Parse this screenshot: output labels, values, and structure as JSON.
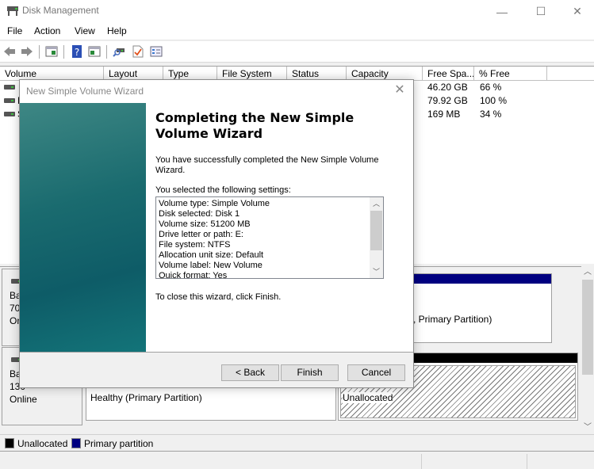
{
  "window": {
    "title": "Disk Management",
    "controls": {
      "minimize": "—",
      "maximize": "☐",
      "close": "✕"
    }
  },
  "menu": [
    "File",
    "Action",
    "View",
    "Help"
  ],
  "toolbar": {
    "icons": [
      "back-arrow",
      "forward-arrow",
      "show-hide-console-tree",
      "help",
      "show-action-pane",
      "connect-disk",
      "check-document",
      "properties-list"
    ]
  },
  "volume_list": {
    "columns": [
      "Volume",
      "Layout",
      "Type",
      "File System",
      "Status",
      "Capacity",
      "Free Spa...",
      "% Free"
    ],
    "rows": [
      {
        "volume": "",
        "free_space": "46.20 GB",
        "pct_free": "66 %"
      },
      {
        "volume": "N",
        "free_space": "79.92 GB",
        "pct_free": "100 %"
      },
      {
        "volume": "S",
        "free_space": "169 MB",
        "pct_free": "34 %"
      }
    ]
  },
  "disk_map": {
    "disks": [
      {
        "line1": "Bas",
        "line2": "70.",
        "line3": "On",
        "partition_text": ", Primary Partition)"
      },
      {
        "line1": "Bas",
        "line2": "130",
        "line3": "Online",
        "partition_text": "Healthy (Primary Partition)",
        "unallocated_label": "Unallocated"
      }
    ]
  },
  "legend": [
    {
      "label": "Unallocated",
      "color": "#000000"
    },
    {
      "label": "Primary partition",
      "color": "#000080"
    }
  ],
  "wizard": {
    "title": "New Simple Volume Wizard",
    "close": "✕",
    "heading": "Completing the New Simple Volume Wizard",
    "success_text": "You have successfully completed the New Simple Volume Wizard.",
    "settings_intro": "You selected the following settings:",
    "settings": [
      "Volume type: Simple Volume",
      "Disk selected: Disk 1",
      "Volume size: 51200 MB",
      "Drive letter or path: E:",
      "File system: NTFS",
      "Allocation unit size: Default",
      "Volume label: New Volume",
      "Quick format: Yes"
    ],
    "close_text": "To close this wizard, click Finish.",
    "buttons": {
      "back": "< Back",
      "finish": "Finish",
      "cancel": "Cancel"
    }
  }
}
